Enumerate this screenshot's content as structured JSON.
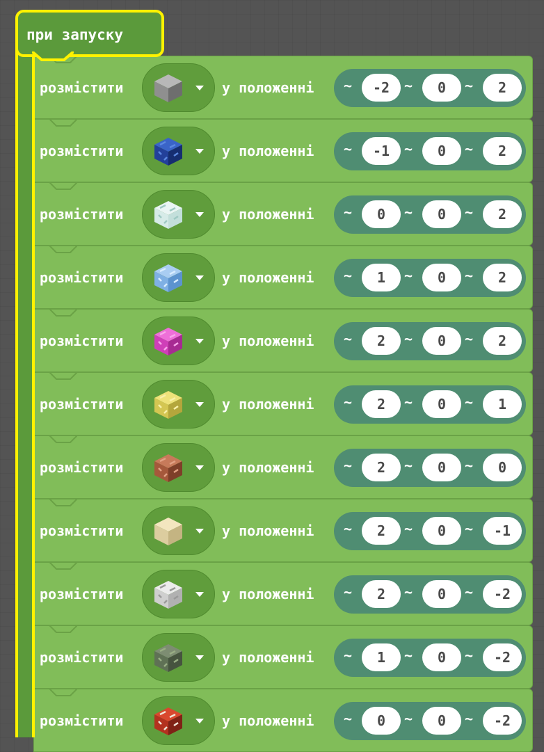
{
  "event": {
    "label": "при запуску"
  },
  "rows": [
    {
      "place_label": "розмістити",
      "block_icon": "stone-block-icon",
      "pos_label": "у положенні",
      "tilde": "~",
      "x": "-2",
      "y": "0",
      "z": "2"
    },
    {
      "place_label": "розмістити",
      "block_icon": "lapis-block-icon",
      "pos_label": "у положенні",
      "tilde": "~",
      "x": "-1",
      "y": "0",
      "z": "2"
    },
    {
      "place_label": "розмістити",
      "block_icon": "glass-block-icon",
      "pos_label": "у положенні",
      "tilde": "~",
      "x": "0",
      "y": "0",
      "z": "2"
    },
    {
      "place_label": "розмістити",
      "block_icon": "ice-block-icon",
      "pos_label": "у положенні",
      "tilde": "~",
      "x": "1",
      "y": "0",
      "z": "2"
    },
    {
      "place_label": "розмістити",
      "block_icon": "magenta-terracotta-block-icon",
      "pos_label": "у положенні",
      "tilde": "~",
      "x": "2",
      "y": "0",
      "z": "2"
    },
    {
      "place_label": "розмістити",
      "block_icon": "sponge-block-icon",
      "pos_label": "у положенні",
      "tilde": "~",
      "x": "2",
      "y": "0",
      "z": "1"
    },
    {
      "place_label": "розмістити",
      "block_icon": "bricks-block-icon",
      "pos_label": "у положенні",
      "tilde": "~",
      "x": "2",
      "y": "0",
      "z": "0"
    },
    {
      "place_label": "розмістити",
      "block_icon": "sandstone-block-icon",
      "pos_label": "у положенні",
      "tilde": "~",
      "x": "2",
      "y": "0",
      "z": "-1"
    },
    {
      "place_label": "розмістити",
      "block_icon": "diorite-block-icon",
      "pos_label": "у положенні",
      "tilde": "~",
      "x": "2",
      "y": "0",
      "z": "-2"
    },
    {
      "place_label": "розмістити",
      "block_icon": "mossy-cobblestone-block-icon",
      "pos_label": "у положенні",
      "tilde": "~",
      "x": "1",
      "y": "0",
      "z": "-2"
    },
    {
      "place_label": "розмістити",
      "block_icon": "tnt-block-icon",
      "pos_label": "у положенні",
      "tilde": "~",
      "x": "0",
      "y": "0",
      "z": "-2"
    }
  ],
  "colors": {
    "workspace": "#545454",
    "block_green": "#81bd59",
    "block_dark_green": "#5b9a3b",
    "coord_teal": "#4f8d72",
    "highlight_yellow": "#fff200"
  }
}
